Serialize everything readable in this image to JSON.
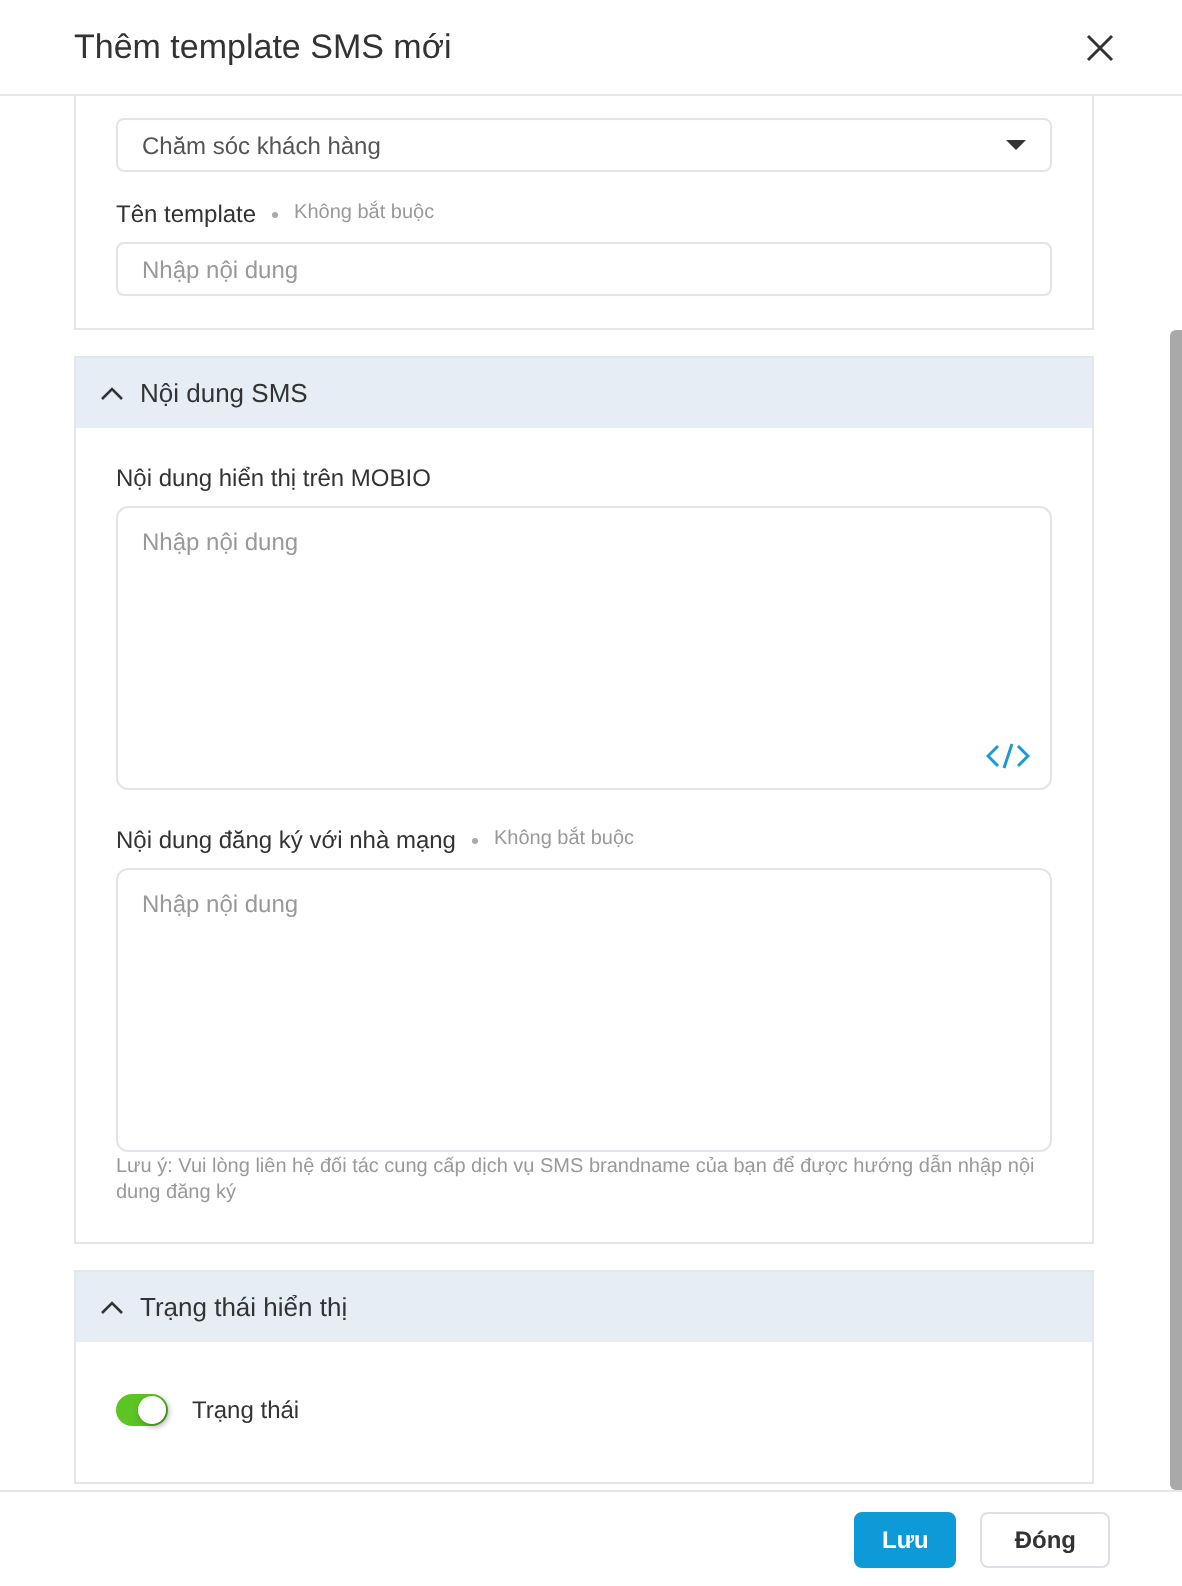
{
  "title": "Thêm template SMS mới",
  "sections": [
    {
      "fields": [
        {
          "kind": "select",
          "value": "Chăm sóc khách hàng"
        },
        {
          "kind": "input",
          "label": "Tên template",
          "optional": "Không bắt buộc",
          "placeholder": "Nhập nội dung"
        }
      ]
    },
    {
      "title": "Nội dung SMS",
      "expanded": true,
      "fields": [
        {
          "kind": "textarea",
          "label": "Nội dung hiển thị trên MOBIO",
          "placeholder": "Nhập nội dung",
          "code_button": true
        },
        {
          "kind": "textarea",
          "label": "Nội dung đăng ký với nhà mạng",
          "optional": "Không bắt buộc",
          "placeholder": "Nhập nội dung",
          "note": "Lưu ý: Vui lòng liên hệ đối tác cung cấp dịch vụ SMS brandname của bạn để được hướng dẫn nhập nội dung đăng ký"
        }
      ]
    },
    {
      "title": "Trạng thái hiển thị",
      "expanded": true,
      "fields": [
        {
          "kind": "toggle",
          "label": "Trạng thái",
          "on": true
        }
      ]
    }
  ],
  "buttons": [
    {
      "label": "Lưu",
      "kind": "primary"
    },
    {
      "label": "Đóng",
      "kind": "secondary"
    }
  ]
}
